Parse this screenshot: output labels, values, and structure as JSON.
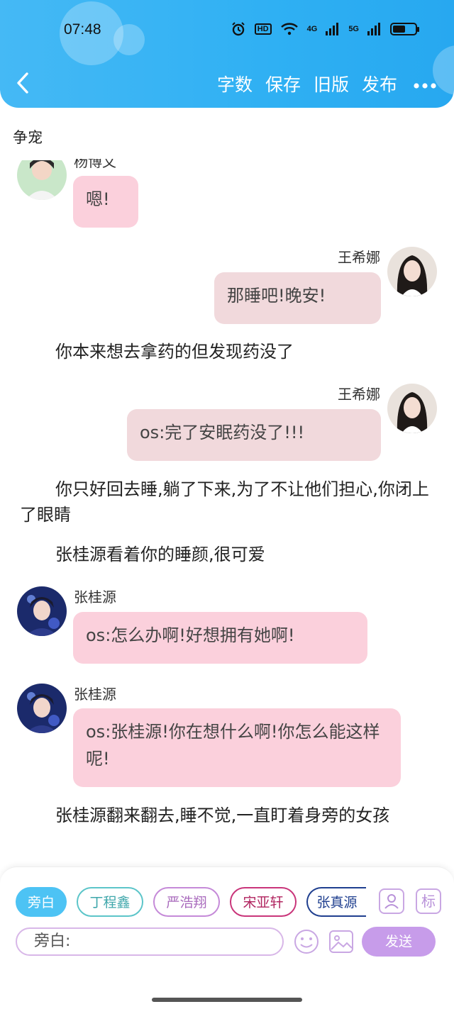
{
  "status_bar": {
    "time": "07:48",
    "hd": "HD",
    "net1": "4G",
    "net2": "5G",
    "battery_level": 0.55
  },
  "toolbar": {
    "back_icon": "chevron-left-icon",
    "actions": [
      "字数",
      "保存",
      "旧版",
      "发布"
    ],
    "more_icon": "more-dots-icon"
  },
  "story": {
    "title": "争宠"
  },
  "messages": [
    {
      "type": "chat",
      "side": "left",
      "name": "杨博文",
      "text": "嗯!",
      "color": "#fbd0dc"
    },
    {
      "type": "chat",
      "side": "right",
      "name": "王希娜",
      "text": "那睡吧!晚安!",
      "color": "#f1d9dc"
    },
    {
      "type": "narration",
      "text": "你本来想去拿药的但发现药没了"
    },
    {
      "type": "chat",
      "side": "right",
      "name": "王希娜",
      "text": "os:完了安眠药没了!!!",
      "color": "#f1d9dc"
    },
    {
      "type": "narration",
      "text": "你只好回去睡,躺了下来,为了不让他们担心,你闭上了眼睛"
    },
    {
      "type": "narration",
      "text": "张桂源看着你的睡颜,很可爱"
    },
    {
      "type": "chat",
      "side": "left",
      "name": "张桂源",
      "text": "os:怎么办啊!好想拥有她啊!",
      "color": "#fbd0dc"
    },
    {
      "type": "chat",
      "side": "left",
      "name": "张桂源",
      "text": "os:张桂源!你在想什么啊!你怎么能这样呢!",
      "color": "#fbd0dc"
    },
    {
      "type": "narration",
      "text": "张桂源翻来翻去,睡不觉,一直盯着身旁的女孩"
    }
  ],
  "composer": {
    "chips": [
      {
        "label": "旁白",
        "color": "#4dc3f4",
        "active": true
      },
      {
        "label": "丁程鑫",
        "color": "#5cc5c9",
        "active": false
      },
      {
        "label": "严浩翔",
        "color": "#c58ad8",
        "active": false
      },
      {
        "label": "宋亚轩",
        "color": "#c9357a",
        "active": false
      },
      {
        "label": "张真源",
        "color": "#1f3f8f",
        "active": false
      }
    ],
    "add_role_icon": "add-role-icon",
    "tag_label": "标",
    "input_placeholder": "旁白:",
    "emoji_icon": "emoji-icon",
    "image_icon": "image-icon",
    "send_label": "发送"
  }
}
